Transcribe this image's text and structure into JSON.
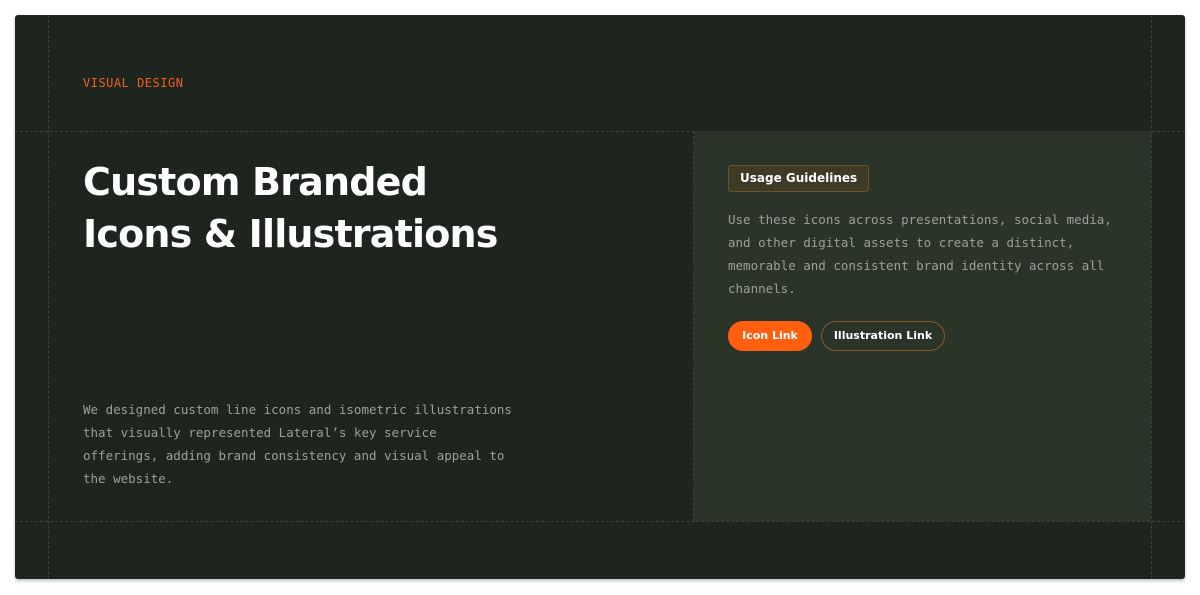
{
  "section": {
    "eyebrow": "VISUAL DESIGN",
    "title_line1": "Custom Branded",
    "title_line2": "Icons & Illustrations",
    "description": "We designed custom line icons and isometric illustrations that visually represented Lateral’s key service offerings, adding brand consistency and visual appeal to the website."
  },
  "panel": {
    "badge": "Usage Guidelines",
    "text": "Use these icons across presentations, social media, and other digital assets to create a distinct, memorable and consistent brand identity across all channels.",
    "buttons": {
      "icon_link": "Icon Link",
      "illustration_link": "Illustration Link"
    }
  },
  "colors": {
    "background": "#1e251f",
    "panel": "#2a3428",
    "accent": "#ff5f0f",
    "text_muted": "#9aa097"
  }
}
